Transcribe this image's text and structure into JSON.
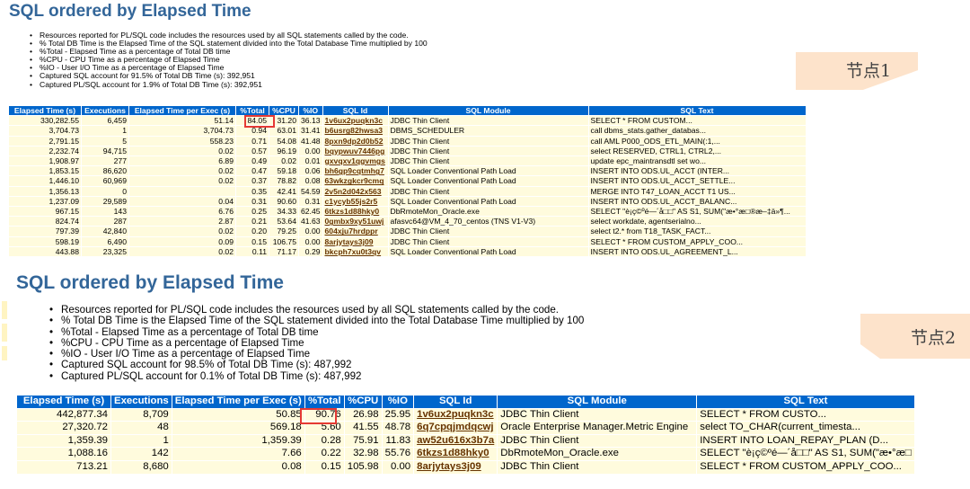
{
  "section1": {
    "title": "SQL ordered by Elapsed Time",
    "bullets": [
      "Resources reported for PL/SQL code includes the resources used by all SQL statements called by the code.",
      "% Total DB Time is the Elapsed Time of the SQL statement divided into the Total Database Time multiplied by 100",
      "%Total - Elapsed Time as a percentage of Total DB time",
      "%CPU - CPU Time as a percentage of Elapsed Time",
      "%IO - User I/O Time as a percentage of Elapsed Time",
      "Captured SQL account for 91.5% of Total DB Time (s): 392,951",
      "Captured PL/SQL account for 1.9% of Total DB Time (s): 392,951"
    ],
    "node_label": "节点1",
    "columns": [
      "Elapsed Time (s)",
      "Executions",
      "Elapsed Time per Exec (s)",
      "%Total",
      "%CPU",
      "%IO",
      "SQL Id",
      "SQL Module",
      "SQL Text"
    ],
    "rows": [
      [
        "330,282.55",
        "6,459",
        "51.14",
        "84.05",
        "31.20",
        "36.13",
        "1v6ux2puqkn3c",
        "JDBC Thin Client",
        "SELECT * FROM CUSTOM..."
      ],
      [
        "3,704.73",
        "1",
        "3,704.73",
        "0.94",
        "63.01",
        "31.41",
        "b6usrg82hwsa3",
        "DBMS_SCHEDULER",
        "call dbms_stats.gather_databas..."
      ],
      [
        "2,791.15",
        "5",
        "558.23",
        "0.71",
        "54.08",
        "41.48",
        "8pxn9dp2d0b52",
        "JDBC Thin Client",
        "call AML P000_ODS_ETL_MAIN(:1,..."
      ],
      [
        "2,232.74",
        "94,715",
        "0.02",
        "0.57",
        "96.19",
        "0.00",
        "bqypwuv7446pg",
        "JDBC Thin Client",
        "select RESERVED, CTRL1, CTRL2,..."
      ],
      [
        "1,908.97",
        "277",
        "6.89",
        "0.49",
        "0.02",
        "0.01",
        "gxvqxv1qgvmgs",
        "JDBC Thin Client",
        "update epc_maintransdtl set wo..."
      ],
      [
        "1,853.15",
        "86,620",
        "0.02",
        "0.47",
        "59.18",
        "0.06",
        "bh6gp9cqtmhg7",
        "SQL Loader Conventional Path Load",
        "INSERT INTO ODS.UL_ACCT (INTER..."
      ],
      [
        "1,446.10",
        "60,969",
        "0.02",
        "0.37",
        "78.82",
        "0.08",
        "63wkzgkcr9cmq",
        "SQL Loader Conventional Path Load",
        "INSERT INTO ODS.UL_ACCT_SETTLE..."
      ],
      [
        "1,356.13",
        "0",
        "",
        "0.35",
        "42.41",
        "54.59",
        "2v5n2d042x563",
        "JDBC Thin Client",
        "MERGE INTO T47_LOAN_ACCT T1 US..."
      ],
      [
        "1,237.09",
        "29,589",
        "0.04",
        "0.31",
        "90.60",
        "0.31",
        "c1ycyb55js2r5",
        "SQL Loader Conventional Path Load",
        "INSERT INTO ODS.UL_ACCT_BALANC..."
      ],
      [
        "967.15",
        "143",
        "6.76",
        "0.25",
        "34.33",
        "62.45",
        "6tkzs1d88hky0",
        "DbRmoteMon_Oracle.exe",
        "SELECT \"è¡ç©ºé—´å□□\" AS S1, SUM(\"æ•°æ□®æ–‡ä»¶..."
      ],
      [
        "824.74",
        "287",
        "2.87",
        "0.21",
        "53.64",
        "41.63",
        "0gmbx9xy51uwj",
        "afasvc64@VM_4_70_centos (TNS V1-V3)",
        "select workdate, agentserialno..."
      ],
      [
        "797.39",
        "42,840",
        "0.02",
        "0.20",
        "79.25",
        "0.00",
        "604xju7hrdppr",
        "JDBC Thin Client",
        "select t2.* from T18_TASK_FACT..."
      ],
      [
        "598.19",
        "6,490",
        "0.09",
        "0.15",
        "106.75",
        "0.00",
        "8arjytays3j09",
        "JDBC Thin Client",
        "SELECT * FROM CUSTOM_APPLY_COO..."
      ],
      [
        "443.88",
        "23,325",
        "0.02",
        "0.11",
        "71.17",
        "0.29",
        "bkcph7xu0t3qv",
        "SQL Loader Conventional Path Load",
        "INSERT INTO ODS.UL_AGREEMENT_L..."
      ]
    ]
  },
  "section2": {
    "title": "SQL ordered by Elapsed Time",
    "bullets": [
      "Resources reported for PL/SQL code includes the resources used by all SQL statements called by the code.",
      "% Total DB Time is the Elapsed Time of the SQL statement divided into the Total Database Time multiplied by 100",
      "%Total - Elapsed Time as a percentage of Total DB time",
      "%CPU - CPU Time as a percentage of Elapsed Time",
      "%IO - User I/O Time as a percentage of Elapsed Time",
      "Captured SQL account for 98.5% of Total DB Time (s): 487,992",
      "Captured PL/SQL account for 0.1% of Total DB Time (s): 487,992"
    ],
    "node_label": "节点2",
    "columns": [
      "Elapsed Time (s)",
      "Executions",
      "Elapsed Time per Exec (s)",
      "%Total",
      "%CPU",
      "%IO",
      "SQL Id",
      "SQL Module",
      "SQL Text"
    ],
    "rows": [
      [
        "442,877.34",
        "8,709",
        "50.85",
        "90.76",
        "26.98",
        "25.95",
        "1v6ux2puqkn3c",
        "JDBC Thin Client",
        "SELECT * FROM CUSTO..."
      ],
      [
        "27,320.72",
        "48",
        "569.18",
        "5.60",
        "41.55",
        "48.78",
        "6q7cpqjmdqcwj",
        "Oracle Enterprise Manager.Metric Engine",
        "select TO_CHAR(current_timesta..."
      ],
      [
        "1,359.39",
        "1",
        "1,359.39",
        "0.28",
        "75.91",
        "11.83",
        "aw52u616x3b7a",
        "JDBC Thin Client",
        "INSERT INTO LOAN_REPAY_PLAN (D..."
      ],
      [
        "1,088.16",
        "142",
        "7.66",
        "0.22",
        "32.98",
        "55.76",
        "6tkzs1d88hky0",
        "DbRmoteMon_Oracle.exe",
        "SELECT \"è¡ç©ºé—´å□□\" AS S1, SUM(\"æ•°æ□"
      ],
      [
        "713.21",
        "8,680",
        "0.08",
        "0.15",
        "105.98",
        "0.00",
        "8arjytays3j09",
        "JDBC Thin Client",
        "SELECT * FROM CUSTOM_APPLY_COO..."
      ]
    ]
  },
  "colors": {
    "title": "#336699",
    "header_bg": "#0066cc",
    "row_bg": "#fffbdd",
    "sql_id_link": "#663300",
    "highlight_border": "#e53935",
    "node_label_bg": "#fde3cb"
  }
}
